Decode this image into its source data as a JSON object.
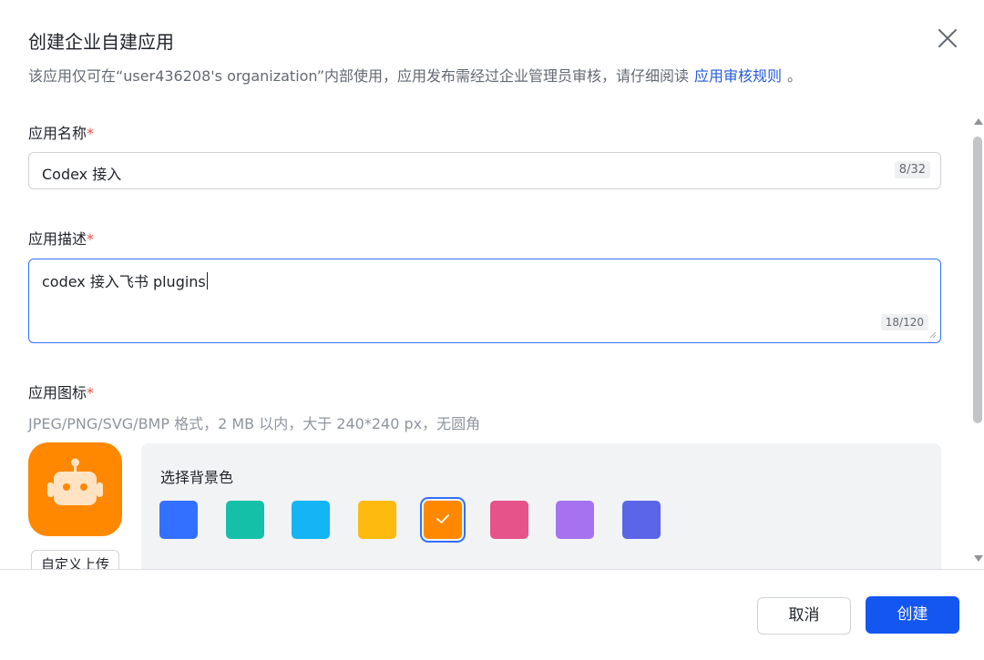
{
  "dialog": {
    "title": "创建企业自建应用",
    "subtitle": "该应用仅可在“user436208's organization”内部使用，应用发布需经过企业管理员审核，请仔细阅读",
    "subtitle_link": "应用审核规则",
    "subtitle_end": "。"
  },
  "name_field": {
    "label": "应用名称",
    "required_mark": "*",
    "value": "Codex 接入",
    "counter": "8/32"
  },
  "desc_field": {
    "label": "应用描述",
    "required_mark": "*",
    "value": "codex 接入飞书 plugins",
    "counter": "18/120"
  },
  "icon_field": {
    "label": "应用图标",
    "required_mark": "*",
    "hint": "JPEG/PNG/SVG/BMP 格式，2 MB 以内，大于 240*240 px，无圆角",
    "upload_label": "自定义上传",
    "icon_name": "robot-icon",
    "icon_bg": "#ff8800"
  },
  "color_picker": {
    "label": "选择背景色",
    "selected_index": 4,
    "swatches": [
      {
        "name": "blue",
        "color": "#3370ff"
      },
      {
        "name": "teal",
        "color": "#14c0a8"
      },
      {
        "name": "cyan",
        "color": "#14b5f5"
      },
      {
        "name": "yellow",
        "color": "#ffba0f"
      },
      {
        "name": "orange",
        "color": "#ff8800"
      },
      {
        "name": "pink",
        "color": "#e6538a"
      },
      {
        "name": "purple",
        "color": "#a672f0"
      },
      {
        "name": "indigo",
        "color": "#5b65e8"
      }
    ]
  },
  "footer": {
    "cancel_label": "取消",
    "create_label": "创建"
  },
  "colors": {
    "primary": "#1456f0",
    "link": "#245bdb",
    "required": "#f54a45",
    "focus_border": "#3370ff"
  }
}
